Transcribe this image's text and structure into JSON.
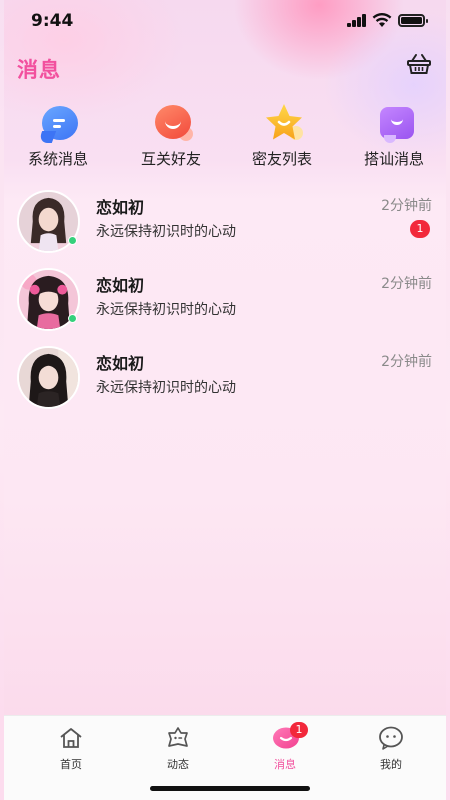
{
  "status_bar": {
    "time": "9:44"
  },
  "header": {
    "title": "消息"
  },
  "categories": [
    {
      "label": "系统消息",
      "icon": "system-message-icon"
    },
    {
      "label": "互关好友",
      "icon": "mutual-friends-icon"
    },
    {
      "label": "密友列表",
      "icon": "star-icon"
    },
    {
      "label": "搭讪消息",
      "icon": "chat-greeting-icon"
    }
  ],
  "messages": [
    {
      "name": "恋如初",
      "text": "永远保持初识时的心动",
      "time": "2分钟前",
      "unread": "1"
    },
    {
      "name": "恋如初",
      "text": "永远保持初识时的心动",
      "time": "2分钟前"
    },
    {
      "name": "恋如初",
      "text": "永远保持初识时的心动",
      "time": "2分钟前"
    }
  ],
  "tabs": [
    {
      "label": "首页",
      "icon": "home-icon"
    },
    {
      "label": "动态",
      "icon": "moments-icon"
    },
    {
      "label": "消息",
      "icon": "message-icon",
      "badge": "1",
      "active": true
    },
    {
      "label": "我的",
      "icon": "profile-icon"
    }
  ],
  "colors": {
    "accent": "#f2509e",
    "badge": "#f2283b",
    "online": "#35d07b"
  }
}
